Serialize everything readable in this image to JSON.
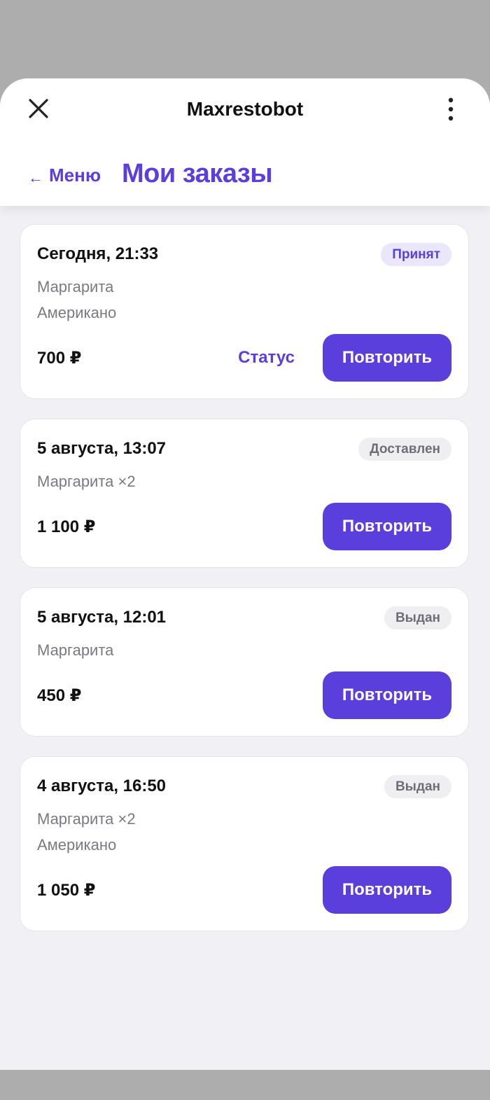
{
  "app": {
    "title": "Maxrestobot"
  },
  "header": {
    "close_icon": "close-icon",
    "more_icon": "vertical-dots-icon",
    "back_arrow": "←",
    "back_label": "Меню",
    "page_title": "Мои заказы"
  },
  "colors": {
    "accent": "#5b3fdc",
    "badge_accepted_bg": "#eae6fb",
    "badge_neutral_bg": "#efeff2",
    "backdrop": "#adadad"
  },
  "orders": [
    {
      "date": "Сегодня, 21:33",
      "status": "Принят",
      "items": [
        "Маргарита",
        "Американо"
      ],
      "price": "700 ₽",
      "status_link": "Статус",
      "repeat_label": "Повторить"
    },
    {
      "date": "5 августа, 13:07",
      "status": "Доставлен",
      "items": [
        "Маргарита ×2"
      ],
      "price": "1 100 ₽",
      "repeat_label": "Повторить"
    },
    {
      "date": "5 августа, 12:01",
      "status": "Выдан",
      "items": [
        "Маргарита"
      ],
      "price": "450 ₽",
      "repeat_label": "Повторить"
    },
    {
      "date": "4 августа, 16:50",
      "status": "Выдан",
      "items": [
        "Маргарита ×2",
        "Американо"
      ],
      "price": "1 050 ₽",
      "repeat_label": "Повторить"
    }
  ]
}
